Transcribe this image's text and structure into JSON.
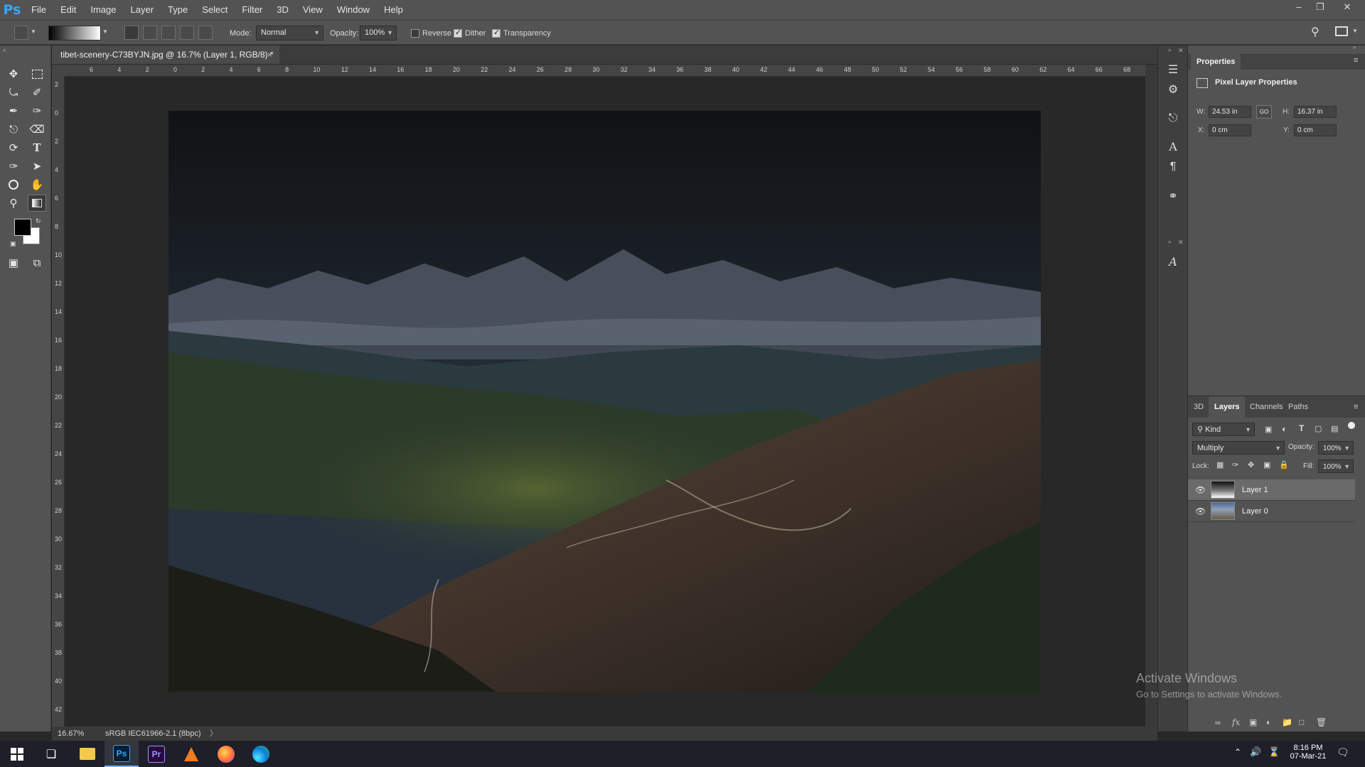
{
  "app": {
    "logo": "Ps"
  },
  "menu": [
    "File",
    "Edit",
    "Image",
    "Layer",
    "Type",
    "Select",
    "Filter",
    "3D",
    "View",
    "Window",
    "Help"
  ],
  "options": {
    "mode_label": "Mode:",
    "mode_value": "Normal",
    "opacity_label": "Opacity:",
    "opacity_value": "100%",
    "reverse_label": "Reverse",
    "dither_label": "Dither",
    "transparency_label": "Transparency",
    "reverse_checked": false,
    "dither_checked": true,
    "transparency_checked": true
  },
  "document": {
    "tab_title": "tibet-scenery-C73BYJN.jpg @ 16.7% (Layer 1, RGB/8) *",
    "close_glyph": "×",
    "zoom": "16.67%",
    "color_profile": "sRGB IEC61966-2.1 (8bpc)",
    "status_arrow": "〉"
  },
  "ruler": {
    "horizontal": [
      "6",
      "4",
      "2",
      "0",
      "2",
      "4",
      "6",
      "8",
      "10",
      "12",
      "14",
      "16",
      "18",
      "20",
      "22",
      "24",
      "26",
      "28",
      "30",
      "32",
      "34",
      "36",
      "38",
      "40",
      "42",
      "44",
      "46",
      "48",
      "50",
      "52",
      "54",
      "56",
      "58",
      "60",
      "62",
      "64",
      "66",
      "68"
    ],
    "vertical": [
      "2",
      "0",
      "2",
      "4",
      "6",
      "8",
      "10",
      "12",
      "14",
      "16",
      "18",
      "20",
      "22",
      "24",
      "26",
      "28",
      "30",
      "32",
      "34",
      "36",
      "38",
      "40",
      "42"
    ]
  },
  "properties": {
    "title": "Properties",
    "subtitle": "Pixel Layer Properties",
    "w_label": "W:",
    "w_value": "24.53 in",
    "h_label": "H:",
    "h_value": "16.37 in",
    "x_label": "X:",
    "x_value": "0 cm",
    "y_label": "Y:",
    "y_value": "0 cm",
    "link_glyph": "GO"
  },
  "layers_panel": {
    "tabs": [
      "3D",
      "Layers",
      "Channels",
      "Paths"
    ],
    "active_tab": "Layers",
    "kind_label": "Kind",
    "blend_mode": "Multiply",
    "opacity_label": "Opacity:",
    "opacity_value": "100%",
    "lock_label": "Lock:",
    "fill_label": "Fill:",
    "fill_value": "100%",
    "layers": [
      {
        "name": "Layer 1",
        "selected": true
      },
      {
        "name": "Layer 0",
        "selected": false
      }
    ]
  },
  "watermark": {
    "title": "Activate Windows",
    "subtitle": "Go to Settings to activate Windows."
  },
  "taskbar": {
    "time": "8:16 PM",
    "date": "07-Mar-21",
    "apps": [
      "start",
      "task-view",
      "file-explorer",
      "photoshop",
      "premiere",
      "vlc",
      "firefox",
      "edge"
    ]
  },
  "colors": {
    "accent": "#31a8ff",
    "panel": "#535353",
    "canvas_bg": "#282828",
    "premiere": "#9999ff",
    "vlc": "#f47b20"
  }
}
